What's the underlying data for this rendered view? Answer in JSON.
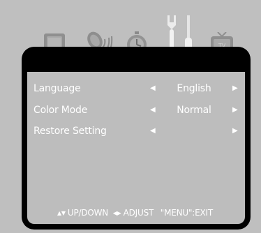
{
  "menu_icons": [
    {
      "name": "picture-icon"
    },
    {
      "name": "sound-icon"
    },
    {
      "name": "timer-icon"
    },
    {
      "name": "setup-icon"
    },
    {
      "name": "tv-icon"
    }
  ],
  "menu": {
    "items": [
      {
        "label": "Language",
        "value": "English"
      },
      {
        "label": "Color Mode",
        "value": "Normal"
      },
      {
        "label": "Restore Setting",
        "value": ""
      }
    ]
  },
  "footer": {
    "updown_glyph": "▲▼",
    "updown_label": "UP/DOWN",
    "adjust_glyph": "◀▶",
    "adjust_label": "ADJUST",
    "exit_label": "\"MENU\":EXIT"
  },
  "colors": {
    "background": "#bfbfbf",
    "frame": "#000000",
    "panel": "#bdbdbd",
    "text": "#ffffff"
  }
}
